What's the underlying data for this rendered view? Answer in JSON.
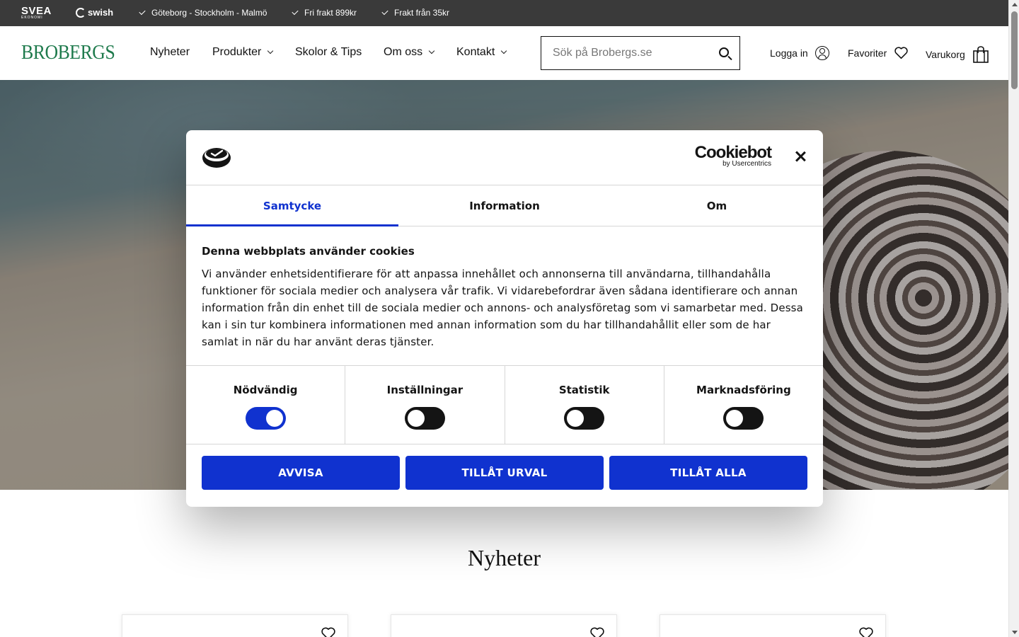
{
  "topbar": {
    "svea_logo": "SVEA",
    "svea_sub": "EKONOMI",
    "swish_logo": "swish",
    "usps": [
      "Göteborg - Stockholm - Malmö",
      "Fri frakt 899kr",
      "Frakt från 35kr"
    ]
  },
  "header": {
    "logo": "BROBERGS",
    "nav": [
      {
        "label": "Nyheter",
        "has_dropdown": false
      },
      {
        "label": "Produkter",
        "has_dropdown": true
      },
      {
        "label": "Skolor & Tips",
        "has_dropdown": false
      },
      {
        "label": "Om oss",
        "has_dropdown": true
      },
      {
        "label": "Kontakt",
        "has_dropdown": true
      }
    ],
    "search_placeholder": "Sök på Brobergs.se",
    "login": "Logga in",
    "favorites": "Favoriter",
    "cart": "Varukorg"
  },
  "section": {
    "title": "Nyheter"
  },
  "dialog": {
    "brand": "Cookiebot",
    "brand_sub": "by Usercentrics",
    "tabs": [
      {
        "label": "Samtycke",
        "active": true
      },
      {
        "label": "Information",
        "active": false
      },
      {
        "label": "Om",
        "active": false
      }
    ],
    "heading": "Denna webbplats använder cookies",
    "text": "Vi använder enhetsidentifierare för att anpassa innehållet och annonserna till användarna, tillhandahålla funktioner för sociala medier och analysera vår trafik. Vi vidarebefordrar även sådana identifierare och annan information från din enhet till de sociala medier och annons- och analysföretag som vi samarbetar med. Dessa kan i sin tur kombinera informationen med annan information som du har tillhandahållit eller som de har samlat in när du har använt deras tjänster.",
    "toggles": [
      {
        "label": "Nödvändig",
        "on": true
      },
      {
        "label": "Inställningar",
        "on": false
      },
      {
        "label": "Statistik",
        "on": false
      },
      {
        "label": "Marknadsföring",
        "on": false
      }
    ],
    "buttons": {
      "reject": "AVVISA",
      "allow_selection": "TILLÅT URVAL",
      "allow_all": "TILLÅT ALLA"
    }
  },
  "colors": {
    "accent": "#1032cf",
    "brand_green": "#1e7a4c",
    "topbar_bg": "#3a3a3a"
  }
}
